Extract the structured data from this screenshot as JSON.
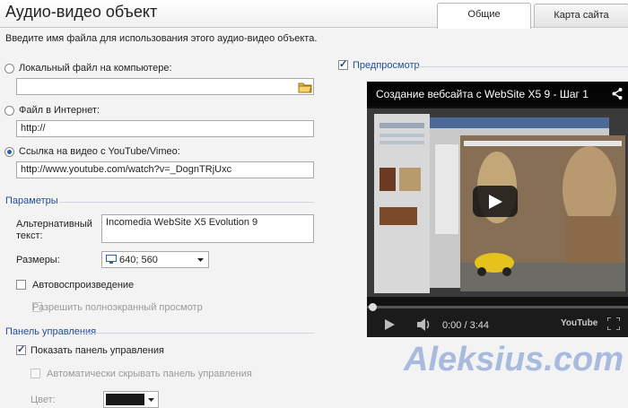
{
  "header": {
    "title": "Аудио-видео объект",
    "tabs": [
      "Общие",
      "Карта сайта"
    ]
  },
  "description": "Введите имя файла для использования этого аудио-видео объекта.",
  "source": {
    "local_label": "Локальный файл на компьютере:",
    "local_value": "",
    "internet_label": "Файл в Интернет:",
    "internet_value": "http://",
    "youtube_label": "Ссылка на видео с YouTube/Vimeo:",
    "youtube_value": "http://www.youtube.com/watch?v=_DognTRjUxc"
  },
  "params": {
    "heading": "Параметры",
    "alt_label_1": "Альтернативный",
    "alt_label_2": "текст:",
    "alt_value": "Incomedia WebSite X5 Evolution 9",
    "size_label": "Размеры:",
    "size_value": "640; 560",
    "autoplay_label": "Автовоспроизведение",
    "fullscreen_label": "Разрешить полноэкранный просмотр"
  },
  "controls": {
    "heading": "Панель управления",
    "show_label": "Показать панель управления",
    "autohide_label": "Автоматически скрывать панель управления",
    "color_label": "Цвет:",
    "color_value": "#1a1a1a"
  },
  "preview": {
    "label": "Предпросмотр",
    "video_title": "Создание вебсайта с WebSite X5 9  - Шаг 1",
    "time": "0:00 / 3:44",
    "youtube": "YouTube",
    "progress": 0
  },
  "watermark": "Aleksius.com",
  "colors": {
    "accent": "#1f4e9c",
    "progress": "#cc181e"
  }
}
